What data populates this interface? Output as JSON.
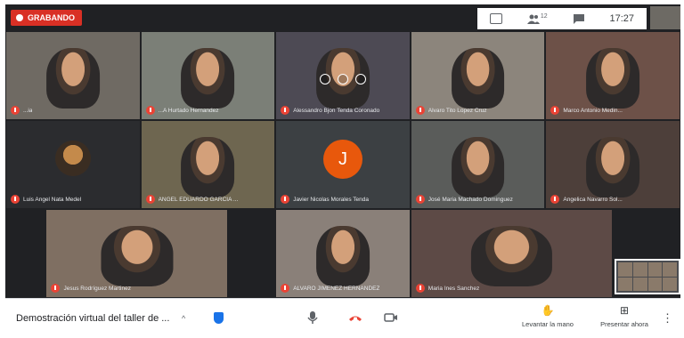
{
  "recording": {
    "label": "GRABANDO"
  },
  "topbar": {
    "participants_count": "12",
    "clock": "17:27",
    "icons": [
      "grid-layout-icon",
      "people-icon",
      "chat-icon"
    ]
  },
  "participants": [
    {
      "name": "...ia",
      "tone": "#6f6a63"
    },
    {
      "name": "...A Hurtado Hernandez",
      "tone": "#7b7f77"
    },
    {
      "name": "Alessandro Bjon Tenda Coronado",
      "tone": "#4d4a54"
    },
    {
      "name": "Alvaro Tito Lopez Cruz",
      "tone": "#8c857c"
    },
    {
      "name": "Marco Antonio Medin...",
      "tone": "#6d5148"
    },
    {
      "name": "Luis Angel Nata Medel",
      "tone": "#2b2c2f",
      "style": "circle"
    },
    {
      "name": "ANGEL EDUARDO GARCIA ...",
      "tone": "#6e6650"
    },
    {
      "name": "Javier Nicolas Morales Tenda",
      "tone": "#3c4043",
      "style": "letter",
      "letter": "J",
      "letter_color": "#e8580c"
    },
    {
      "name": "José Maria Machado Dominguez",
      "tone": "#5a5c5a"
    },
    {
      "name": "Angelica Navarro Sol...",
      "tone": "#4d3f3a"
    },
    {
      "name": "Jesus Rodríguez Martinez",
      "tone": "#7f6f62"
    },
    {
      "name": "ALVARO JIMENEZ HERNANDEZ",
      "tone": "#8a8079"
    },
    {
      "name": "Maria Ines Sanchez",
      "tone": "#5d4a46"
    }
  ],
  "bottom": {
    "meeting_title": "Demostración virtual del taller de ...",
    "chevron": "^",
    "raise_hand": "Levantar la mano",
    "present": "Presentar ahora",
    "more": "⋮"
  },
  "colors": {
    "record_red": "#d93025",
    "hangup_red": "#ea4335",
    "shield_blue": "#1a73e8"
  }
}
